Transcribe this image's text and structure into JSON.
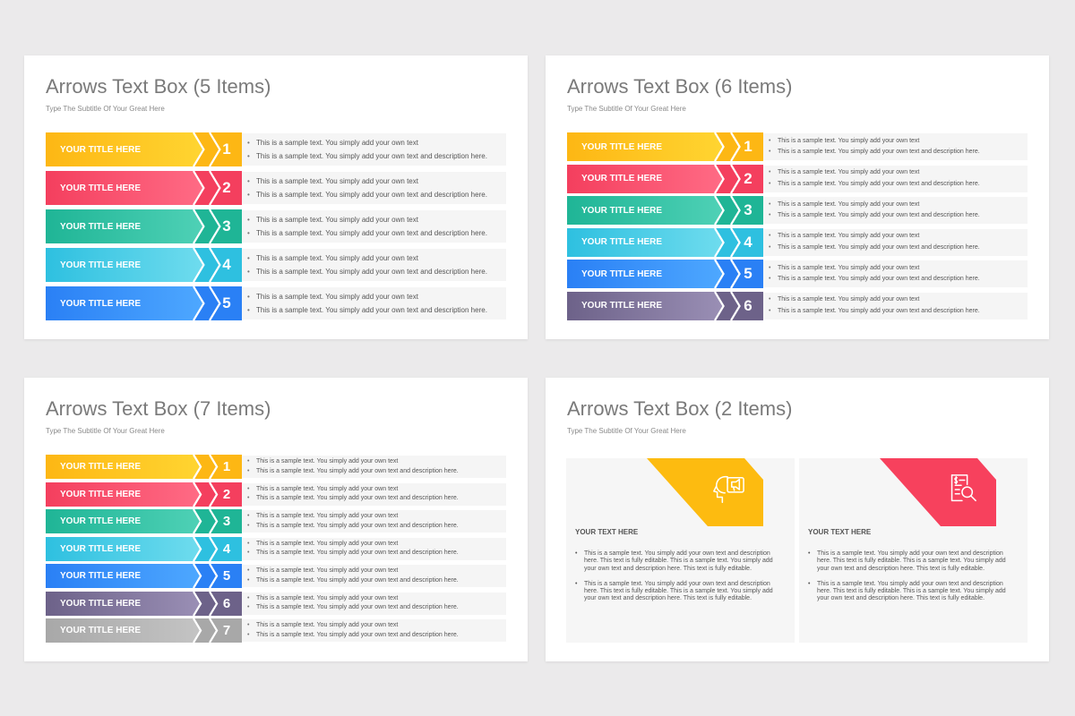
{
  "colors": {
    "yellow": [
      "#ffd531",
      "#fdb714"
    ],
    "red": [
      "#ff6b85",
      "#f43f5e"
    ],
    "green": [
      "#4fd1b6",
      "#1fb596"
    ],
    "cyan": [
      "#6fdcee",
      "#2ec0e0"
    ],
    "blue": [
      "#4ea8ff",
      "#2a80f5"
    ],
    "purple": [
      "#9a8fb5",
      "#6d6289"
    ],
    "gray": [
      "#c4c4c4",
      "#a8a8a8"
    ]
  },
  "slides": [
    {
      "title": "Arrows Text Box (5 Items)",
      "subtitle": "Type The Subtitle Of Your Great Here",
      "rows": [
        {
          "title": "YOUR TITLE HERE",
          "number": "1",
          "color": "yellow",
          "line1": "This is a sample text. You simply add your own text",
          "line2": "This is a sample text. You simply add your own text and description here."
        },
        {
          "title": "YOUR TITLE HERE",
          "number": "2",
          "color": "red",
          "line1": "This is a sample text. You simply add your own text",
          "line2": "This is a sample text. You simply add your own text and description here."
        },
        {
          "title": "YOUR TITLE HERE",
          "number": "3",
          "color": "green",
          "line1": "This is a sample text. You simply add your own text",
          "line2": "This is a sample text. You simply add your own text and description here."
        },
        {
          "title": "YOUR TITLE HERE",
          "number": "4",
          "color": "cyan",
          "line1": "This is a sample text. You simply add your own text",
          "line2": "This is a sample text. You simply add your own text and description here."
        },
        {
          "title": "YOUR TITLE HERE",
          "number": "5",
          "color": "blue",
          "line1": "This is a sample text. You simply add your own text",
          "line2": "This is a sample text. You simply add your own text and description here."
        }
      ]
    },
    {
      "title": "Arrows Text Box (6 Items)",
      "subtitle": "Type The Subtitle Of Your Great Here",
      "rows": [
        {
          "title": "YOUR TITLE HERE",
          "number": "1",
          "color": "yellow",
          "line1": "This is a sample text. You simply add your own text",
          "line2": "This is a sample text. You simply add your own text and description here."
        },
        {
          "title": "YOUR TITLE HERE",
          "number": "2",
          "color": "red",
          "line1": "This is a sample text. You simply add your own text",
          "line2": "This is a sample text. You simply add your own text and description here."
        },
        {
          "title": "YOUR TITLE HERE",
          "number": "3",
          "color": "green",
          "line1": "This is a sample text. You simply add your own text",
          "line2": "This is a sample text. You simply add your own text and description here."
        },
        {
          "title": "YOUR TITLE HERE",
          "number": "4",
          "color": "cyan",
          "line1": "This is a sample text. You simply add your own text",
          "line2": "This is a sample text. You simply add your own text and description here."
        },
        {
          "title": "YOUR TITLE HERE",
          "number": "5",
          "color": "blue",
          "line1": "This is a sample text. You simply add your own text",
          "line2": "This is a sample text. You simply add your own text and description here."
        },
        {
          "title": "YOUR TITLE HERE",
          "number": "6",
          "color": "purple",
          "line1": "This is a sample text. You simply add your own text",
          "line2": "This is a sample text. You simply add your own text and description here."
        }
      ]
    },
    {
      "title": "Arrows Text Box (7 Items)",
      "subtitle": "Type The Subtitle Of Your Great Here",
      "rows": [
        {
          "title": "YOUR TITLE HERE",
          "number": "1",
          "color": "yellow",
          "line1": "This is a sample text. You simply add your own text",
          "line2": "This is a sample text. You simply add your own text and description here."
        },
        {
          "title": "YOUR TITLE HERE",
          "number": "2",
          "color": "red",
          "line1": "This is a sample text. You simply add your own text",
          "line2": "This is a sample text. You simply add your own text and description here."
        },
        {
          "title": "YOUR TITLE HERE",
          "number": "3",
          "color": "green",
          "line1": "This is a sample text. You simply add your own text",
          "line2": "This is a sample text. You simply add your own text and description here."
        },
        {
          "title": "YOUR TITLE HERE",
          "number": "4",
          "color": "cyan",
          "line1": "This is a sample text. You simply add your own text",
          "line2": "This is a sample text. You simply add your own text and description here."
        },
        {
          "title": "YOUR TITLE HERE",
          "number": "5",
          "color": "blue",
          "line1": "This is a sample text. You simply add your own text",
          "line2": "This is a sample text. You simply add your own text and description here."
        },
        {
          "title": "YOUR TITLE HERE",
          "number": "6",
          "color": "purple",
          "line1": "This is a sample text. You simply add your own text",
          "line2": "This is a sample text. You simply add your own text and description here."
        },
        {
          "title": "YOUR TITLE HERE",
          "number": "7",
          "color": "gray",
          "line1": "This is a sample text. You simply add your own text",
          "line2": "This is a sample text. You simply add your own text and description here."
        }
      ]
    },
    {
      "title": "Arrows Text Box (2 Items)",
      "subtitle": "Type The Subtitle Of Your Great Here",
      "cards": [
        {
          "color": "#fdbb10",
          "icon": "megaphone-head-icon",
          "heading": "YOUR TEXT HERE",
          "bullets": [
            "This is a sample text. You simply add your own text and description here. This text is fully editable. This is a sample text. You simply add your own text and description here. This text is fully editable.",
            "This is a sample text. You simply add your own text and description here. This text is fully editable. This is a sample text. You simply add your own text and description here. This text is fully editable."
          ]
        },
        {
          "color": "#f7415d",
          "icon": "document-search-icon",
          "heading": "YOUR TEXT HERE",
          "bullets": [
            "This is a sample text. You simply add your own text and description here. This text is fully editable. This is a sample text. You simply add your own text and description here. This text is fully editable.",
            "This is a sample text. You simply add your own text and description here. This text is fully editable. This is a sample text. You simply add your own text and description here. This text is fully editable."
          ]
        }
      ]
    }
  ]
}
